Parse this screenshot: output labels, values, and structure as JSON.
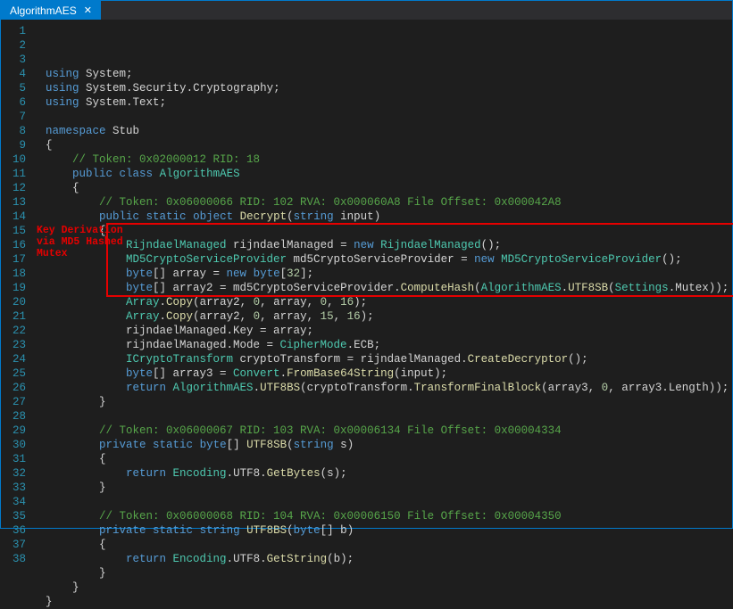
{
  "tab": {
    "title": "AlgorithmAES",
    "close": "✕"
  },
  "annotation": {
    "line1": "Key Derivation",
    "line2": "via MD5 Hashed",
    "line3": "Mutex"
  },
  "code": {
    "lines": [
      {
        "n": 1,
        "tokens": [
          {
            "c": "kw",
            "t": "using"
          },
          {
            "c": "id",
            "t": " System"
          },
          {
            "c": "punc",
            "t": ";"
          }
        ]
      },
      {
        "n": 2,
        "tokens": [
          {
            "c": "kw",
            "t": "using"
          },
          {
            "c": "id",
            "t": " System"
          },
          {
            "c": "punc",
            "t": "."
          },
          {
            "c": "id",
            "t": "Security"
          },
          {
            "c": "punc",
            "t": "."
          },
          {
            "c": "id",
            "t": "Cryptography"
          },
          {
            "c": "punc",
            "t": ";"
          }
        ]
      },
      {
        "n": 3,
        "tokens": [
          {
            "c": "kw",
            "t": "using"
          },
          {
            "c": "id",
            "t": " System"
          },
          {
            "c": "punc",
            "t": "."
          },
          {
            "c": "id",
            "t": "Text"
          },
          {
            "c": "punc",
            "t": ";"
          }
        ]
      },
      {
        "n": 4,
        "tokens": []
      },
      {
        "n": 5,
        "tokens": [
          {
            "c": "kw",
            "t": "namespace"
          },
          {
            "c": "id",
            "t": " Stub"
          }
        ]
      },
      {
        "n": 6,
        "tokens": [
          {
            "c": "punc",
            "t": "{"
          }
        ]
      },
      {
        "n": 7,
        "tokens": [
          {
            "c": "punc",
            "t": "    "
          },
          {
            "c": "cmt",
            "t": "// Token: 0x02000012 RID: 18"
          }
        ]
      },
      {
        "n": 8,
        "tokens": [
          {
            "c": "punc",
            "t": "    "
          },
          {
            "c": "kw",
            "t": "public"
          },
          {
            "c": "id",
            "t": " "
          },
          {
            "c": "kw",
            "t": "class"
          },
          {
            "c": "id",
            "t": " "
          },
          {
            "c": "type",
            "t": "AlgorithmAES"
          }
        ]
      },
      {
        "n": 9,
        "tokens": [
          {
            "c": "punc",
            "t": "    {"
          }
        ]
      },
      {
        "n": 10,
        "tokens": [
          {
            "c": "punc",
            "t": "        "
          },
          {
            "c": "cmt",
            "t": "// Token: 0x06000066 RID: 102 RVA: 0x000060A8 File Offset: 0x000042A8"
          }
        ]
      },
      {
        "n": 11,
        "tokens": [
          {
            "c": "punc",
            "t": "        "
          },
          {
            "c": "kw",
            "t": "public"
          },
          {
            "c": "punc",
            "t": " "
          },
          {
            "c": "kw",
            "t": "static"
          },
          {
            "c": "punc",
            "t": " "
          },
          {
            "c": "kw",
            "t": "object"
          },
          {
            "c": "punc",
            "t": " "
          },
          {
            "c": "meth",
            "t": "Decrypt"
          },
          {
            "c": "punc",
            "t": "("
          },
          {
            "c": "kw",
            "t": "string"
          },
          {
            "c": "punc",
            "t": " "
          },
          {
            "c": "id",
            "t": "input"
          },
          {
            "c": "punc",
            "t": ")"
          }
        ]
      },
      {
        "n": 12,
        "tokens": [
          {
            "c": "punc",
            "t": "        {"
          }
        ]
      },
      {
        "n": 13,
        "tokens": [
          {
            "c": "punc",
            "t": "            "
          },
          {
            "c": "type",
            "t": "RijndaelManaged"
          },
          {
            "c": "punc",
            "t": " rijndaelManaged = "
          },
          {
            "c": "kw",
            "t": "new"
          },
          {
            "c": "punc",
            "t": " "
          },
          {
            "c": "type",
            "t": "RijndaelManaged"
          },
          {
            "c": "punc",
            "t": "();"
          }
        ]
      },
      {
        "n": 14,
        "tokens": [
          {
            "c": "punc",
            "t": "            "
          },
          {
            "c": "type",
            "t": "MD5CryptoServiceProvider"
          },
          {
            "c": "punc",
            "t": " md5CryptoServiceProvider = "
          },
          {
            "c": "kw",
            "t": "new"
          },
          {
            "c": "punc",
            "t": " "
          },
          {
            "c": "type",
            "t": "MD5CryptoServiceProvider"
          },
          {
            "c": "punc",
            "t": "();"
          }
        ]
      },
      {
        "n": 15,
        "tokens": [
          {
            "c": "punc",
            "t": "            "
          },
          {
            "c": "kw",
            "t": "byte"
          },
          {
            "c": "punc",
            "t": "[] array = "
          },
          {
            "c": "kw",
            "t": "new"
          },
          {
            "c": "punc",
            "t": " "
          },
          {
            "c": "kw",
            "t": "byte"
          },
          {
            "c": "punc",
            "t": "["
          },
          {
            "c": "num",
            "t": "32"
          },
          {
            "c": "punc",
            "t": "];"
          }
        ]
      },
      {
        "n": 16,
        "tokens": [
          {
            "c": "punc",
            "t": "            "
          },
          {
            "c": "kw",
            "t": "byte"
          },
          {
            "c": "punc",
            "t": "[] array2 = md5CryptoServiceProvider."
          },
          {
            "c": "meth",
            "t": "ComputeHash"
          },
          {
            "c": "punc",
            "t": "("
          },
          {
            "c": "type",
            "t": "AlgorithmAES"
          },
          {
            "c": "punc",
            "t": "."
          },
          {
            "c": "meth",
            "t": "UTF8SB"
          },
          {
            "c": "punc",
            "t": "("
          },
          {
            "c": "type",
            "t": "Settings"
          },
          {
            "c": "punc",
            "t": ".Mutex));"
          }
        ]
      },
      {
        "n": 17,
        "tokens": [
          {
            "c": "punc",
            "t": "            "
          },
          {
            "c": "type",
            "t": "Array"
          },
          {
            "c": "punc",
            "t": "."
          },
          {
            "c": "meth",
            "t": "Copy"
          },
          {
            "c": "punc",
            "t": "(array2, "
          },
          {
            "c": "num",
            "t": "0"
          },
          {
            "c": "punc",
            "t": ", array, "
          },
          {
            "c": "num",
            "t": "0"
          },
          {
            "c": "punc",
            "t": ", "
          },
          {
            "c": "num",
            "t": "16"
          },
          {
            "c": "punc",
            "t": ");"
          }
        ]
      },
      {
        "n": 18,
        "tokens": [
          {
            "c": "punc",
            "t": "            "
          },
          {
            "c": "type",
            "t": "Array"
          },
          {
            "c": "punc",
            "t": "."
          },
          {
            "c": "meth",
            "t": "Copy"
          },
          {
            "c": "punc",
            "t": "(array2, "
          },
          {
            "c": "num",
            "t": "0"
          },
          {
            "c": "punc",
            "t": ", array, "
          },
          {
            "c": "num",
            "t": "15"
          },
          {
            "c": "punc",
            "t": ", "
          },
          {
            "c": "num",
            "t": "16"
          },
          {
            "c": "punc",
            "t": ");"
          }
        ]
      },
      {
        "n": 19,
        "tokens": [
          {
            "c": "punc",
            "t": "            rijndaelManaged.Key = array;"
          }
        ]
      },
      {
        "n": 20,
        "tokens": [
          {
            "c": "punc",
            "t": "            rijndaelManaged.Mode = "
          },
          {
            "c": "type",
            "t": "CipherMode"
          },
          {
            "c": "punc",
            "t": ".ECB;"
          }
        ]
      },
      {
        "n": 21,
        "tokens": [
          {
            "c": "punc",
            "t": "            "
          },
          {
            "c": "type",
            "t": "ICryptoTransform"
          },
          {
            "c": "punc",
            "t": " cryptoTransform = rijndaelManaged."
          },
          {
            "c": "meth",
            "t": "CreateDecryptor"
          },
          {
            "c": "punc",
            "t": "();"
          }
        ]
      },
      {
        "n": 22,
        "tokens": [
          {
            "c": "punc",
            "t": "            "
          },
          {
            "c": "kw",
            "t": "byte"
          },
          {
            "c": "punc",
            "t": "[] array3 = "
          },
          {
            "c": "type",
            "t": "Convert"
          },
          {
            "c": "punc",
            "t": "."
          },
          {
            "c": "meth",
            "t": "FromBase64String"
          },
          {
            "c": "punc",
            "t": "(input);"
          }
        ]
      },
      {
        "n": 23,
        "tokens": [
          {
            "c": "punc",
            "t": "            "
          },
          {
            "c": "kw",
            "t": "return"
          },
          {
            "c": "punc",
            "t": " "
          },
          {
            "c": "type",
            "t": "AlgorithmAES"
          },
          {
            "c": "punc",
            "t": "."
          },
          {
            "c": "meth",
            "t": "UTF8BS"
          },
          {
            "c": "punc",
            "t": "(cryptoTransform."
          },
          {
            "c": "meth",
            "t": "TransformFinalBlock"
          },
          {
            "c": "punc",
            "t": "(array3, "
          },
          {
            "c": "num",
            "t": "0"
          },
          {
            "c": "punc",
            "t": ", array3.Length));"
          }
        ]
      },
      {
        "n": 24,
        "tokens": [
          {
            "c": "punc",
            "t": "        }"
          }
        ]
      },
      {
        "n": 25,
        "tokens": []
      },
      {
        "n": 26,
        "tokens": [
          {
            "c": "punc",
            "t": "        "
          },
          {
            "c": "cmt",
            "t": "// Token: 0x06000067 RID: 103 RVA: 0x00006134 File Offset: 0x00004334"
          }
        ]
      },
      {
        "n": 27,
        "tokens": [
          {
            "c": "punc",
            "t": "        "
          },
          {
            "c": "kw",
            "t": "private"
          },
          {
            "c": "punc",
            "t": " "
          },
          {
            "c": "kw",
            "t": "static"
          },
          {
            "c": "punc",
            "t": " "
          },
          {
            "c": "kw",
            "t": "byte"
          },
          {
            "c": "punc",
            "t": "[] "
          },
          {
            "c": "meth",
            "t": "UTF8SB"
          },
          {
            "c": "punc",
            "t": "("
          },
          {
            "c": "kw",
            "t": "string"
          },
          {
            "c": "punc",
            "t": " "
          },
          {
            "c": "id",
            "t": "s"
          },
          {
            "c": "punc",
            "t": ")"
          }
        ]
      },
      {
        "n": 28,
        "tokens": [
          {
            "c": "punc",
            "t": "        {"
          }
        ]
      },
      {
        "n": 29,
        "tokens": [
          {
            "c": "punc",
            "t": "            "
          },
          {
            "c": "kw",
            "t": "return"
          },
          {
            "c": "punc",
            "t": " "
          },
          {
            "c": "type",
            "t": "Encoding"
          },
          {
            "c": "punc",
            "t": ".UTF8."
          },
          {
            "c": "meth",
            "t": "GetBytes"
          },
          {
            "c": "punc",
            "t": "("
          },
          {
            "c": "id",
            "t": "s"
          },
          {
            "c": "punc",
            "t": ");"
          }
        ]
      },
      {
        "n": 30,
        "tokens": [
          {
            "c": "punc",
            "t": "        }"
          }
        ]
      },
      {
        "n": 31,
        "tokens": []
      },
      {
        "n": 32,
        "tokens": [
          {
            "c": "punc",
            "t": "        "
          },
          {
            "c": "cmt",
            "t": "// Token: 0x06000068 RID: 104 RVA: 0x00006150 File Offset: 0x00004350"
          }
        ]
      },
      {
        "n": 33,
        "tokens": [
          {
            "c": "punc",
            "t": "        "
          },
          {
            "c": "kw",
            "t": "private"
          },
          {
            "c": "punc",
            "t": " "
          },
          {
            "c": "kw",
            "t": "static"
          },
          {
            "c": "punc",
            "t": " "
          },
          {
            "c": "kw",
            "t": "string"
          },
          {
            "c": "punc",
            "t": " "
          },
          {
            "c": "meth",
            "t": "UTF8BS"
          },
          {
            "c": "punc",
            "t": "("
          },
          {
            "c": "kw",
            "t": "byte"
          },
          {
            "c": "punc",
            "t": "[] "
          },
          {
            "c": "id",
            "t": "b"
          },
          {
            "c": "punc",
            "t": ")"
          }
        ]
      },
      {
        "n": 34,
        "tokens": [
          {
            "c": "punc",
            "t": "        {"
          }
        ]
      },
      {
        "n": 35,
        "tokens": [
          {
            "c": "punc",
            "t": "            "
          },
          {
            "c": "kw",
            "t": "return"
          },
          {
            "c": "punc",
            "t": " "
          },
          {
            "c": "type",
            "t": "Encoding"
          },
          {
            "c": "punc",
            "t": ".UTF8."
          },
          {
            "c": "meth",
            "t": "GetString"
          },
          {
            "c": "punc",
            "t": "("
          },
          {
            "c": "id",
            "t": "b"
          },
          {
            "c": "punc",
            "t": ");"
          }
        ]
      },
      {
        "n": 36,
        "tokens": [
          {
            "c": "punc",
            "t": "        }"
          }
        ]
      },
      {
        "n": 37,
        "tokens": [
          {
            "c": "punc",
            "t": "    }"
          }
        ]
      },
      {
        "n": 38,
        "tokens": [
          {
            "c": "punc",
            "t": "}"
          }
        ]
      }
    ]
  }
}
